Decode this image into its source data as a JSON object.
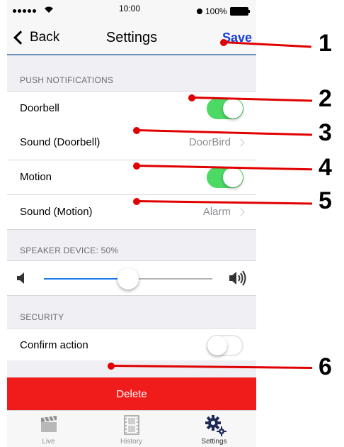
{
  "status_bar": {
    "carrier_dots": "•••••",
    "time": "10:00",
    "battery": "100%"
  },
  "nav": {
    "back_label": "Back",
    "title": "Settings",
    "save_label": "Save"
  },
  "sections": {
    "push": "PUSH NOTIFICATIONS",
    "speaker": "SPEAKER DEVICE: 50%",
    "security": "SECURITY"
  },
  "rows": {
    "doorbell": {
      "label": "Doorbell",
      "enabled": true
    },
    "sound_doorbell": {
      "label": "Sound (Doorbell)",
      "value": "DoorBird"
    },
    "motion": {
      "label": "Motion",
      "enabled": true
    },
    "sound_motion": {
      "label": "Sound (Motion)",
      "value": "Alarm"
    },
    "confirm": {
      "label": "Confirm action",
      "enabled": false
    }
  },
  "speaker_volume": 0.5,
  "delete_label": "Delete",
  "tabs": [
    {
      "label": "Live",
      "icon": "clapperboard-icon",
      "active": false
    },
    {
      "label": "History",
      "icon": "film-icon",
      "active": false
    },
    {
      "label": "Settings",
      "icon": "gears-icon",
      "active": true
    }
  ],
  "annotations": [
    {
      "number": "1",
      "target": "save"
    },
    {
      "number": "2",
      "target": "doorbell"
    },
    {
      "number": "3",
      "target": "sound-doorbell"
    },
    {
      "number": "4",
      "target": "motion"
    },
    {
      "number": "5",
      "target": "sound-motion"
    },
    {
      "number": "6",
      "target": "delete-gap"
    }
  ],
  "colors": {
    "toggle_on": "#4cd964",
    "accent_blue": "#1d7cf2",
    "save_blue": "#1c3fd6",
    "delete_red": "#f01c1c",
    "annotation_red": "#e00000"
  }
}
